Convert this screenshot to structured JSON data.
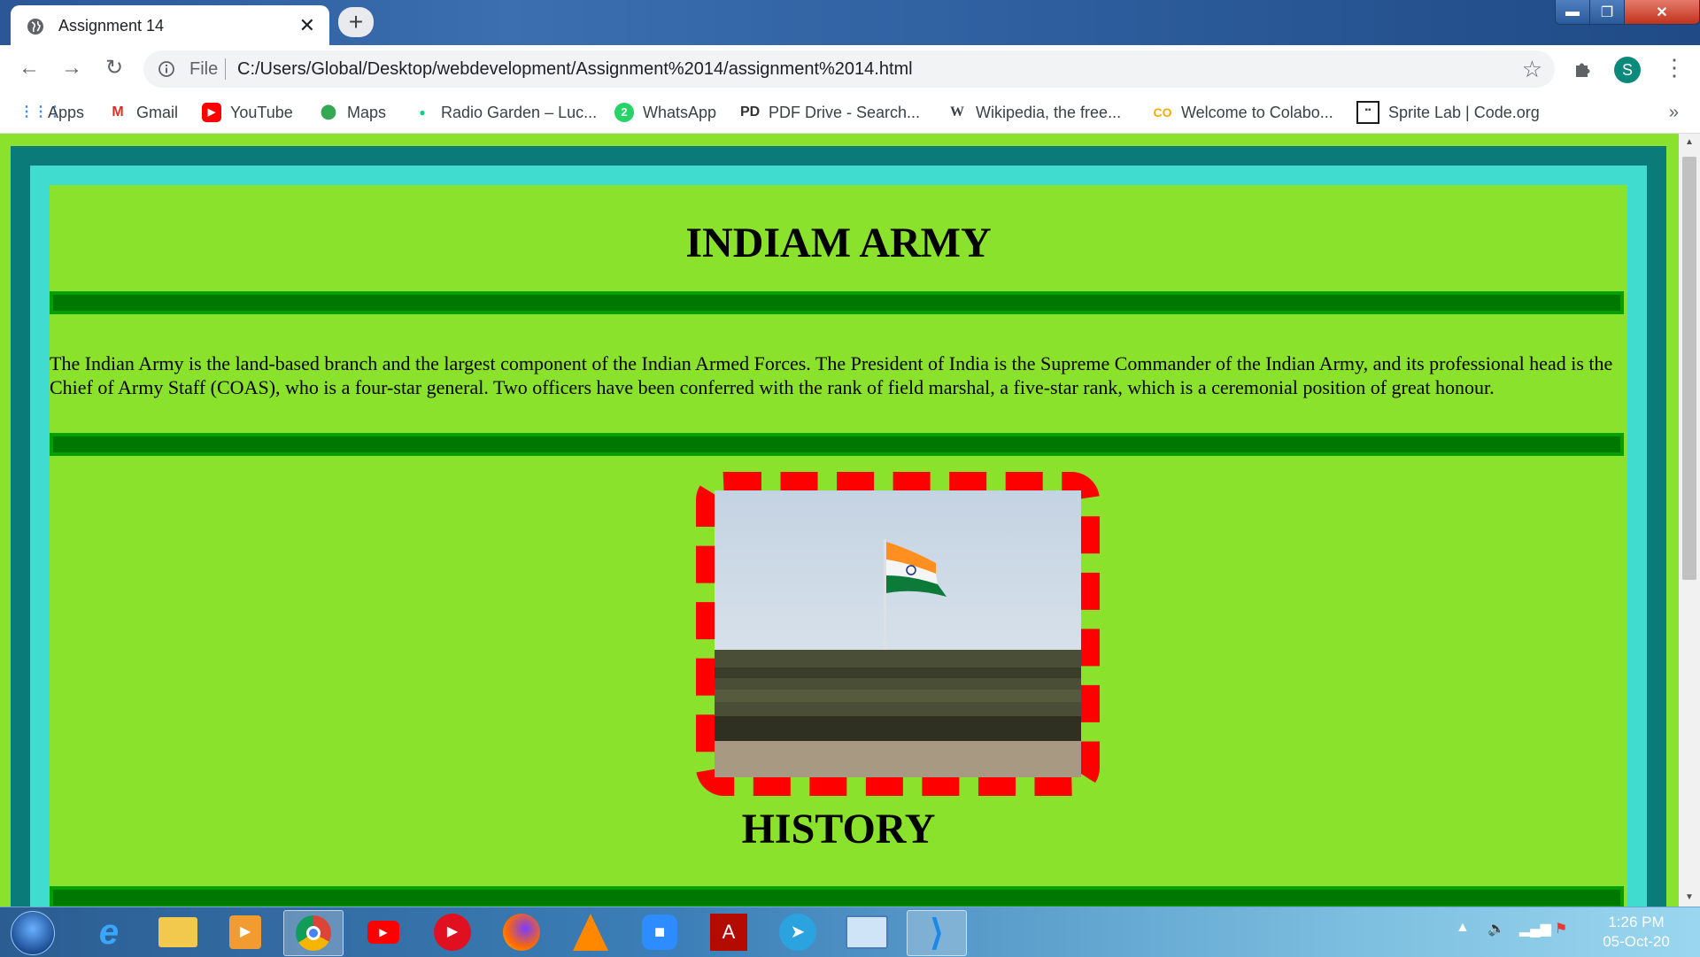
{
  "browser": {
    "tab_title": "Assignment 14",
    "file_label": "File",
    "url": "C:/Users/Global/Desktop/webdevelopment/Assignment%2014/assignment%2014.html",
    "avatar_letter": "S"
  },
  "bookmarks": [
    {
      "label": "Apps",
      "icon": "apps-grid-icon",
      "color": "#4285f4"
    },
    {
      "label": "Gmail",
      "icon": "gmail-icon",
      "color": "#d93025"
    },
    {
      "label": "YouTube",
      "icon": "youtube-icon",
      "color": "#ff0000"
    },
    {
      "label": "Maps",
      "icon": "maps-pin-icon",
      "color": "#34a853"
    },
    {
      "label": "Radio Garden – Luc...",
      "icon": "radio-garden-icon",
      "color": "#00d084"
    },
    {
      "label": "WhatsApp",
      "icon": "whatsapp-icon",
      "color": "#25d366"
    },
    {
      "label": "PDF Drive - Search...",
      "icon": "pdf-drive-icon",
      "color": "#333333"
    },
    {
      "label": "Wikipedia, the free...",
      "icon": "wikipedia-icon",
      "color": "#000000"
    },
    {
      "label": "Welcome to Colabo...",
      "icon": "colab-icon",
      "color": "#f9ab00"
    },
    {
      "label": "Sprite Lab | Code.org",
      "icon": "code-org-icon",
      "color": "#1b1b1b"
    }
  ],
  "page": {
    "heading": "INDIAM ARMY",
    "paragraph": "The Indian Army is the land-based branch and the largest component of the Indian Armed Forces. The President of India is the Supreme Commander of the Indian Army, and its professional head is the Chief of Army Staff (COAS), who is a four-star general. Two officers have been conferred with the rank of field marshal, a five-star rank, which is a ceremonial position of great honour.",
    "history_heading": "HISTORY",
    "colors": {
      "page_bg": "#8ae22c",
      "outer_border": "#0a7b79",
      "inner_border": "#40dcd0",
      "rule": "#007800",
      "image_border": "#ff0000"
    }
  },
  "taskbar": {
    "apps": [
      "internet-explorer-icon",
      "file-explorer-icon",
      "media-player-icon",
      "chrome-icon",
      "youtube-app-icon",
      "music-player-icon",
      "firefox-icon",
      "vlc-icon",
      "zoom-icon",
      "acrobat-icon",
      "telegram-icon",
      "remote-desktop-icon",
      "vscode-icon"
    ],
    "time": "1:26 PM",
    "date": "05-Oct-20"
  }
}
